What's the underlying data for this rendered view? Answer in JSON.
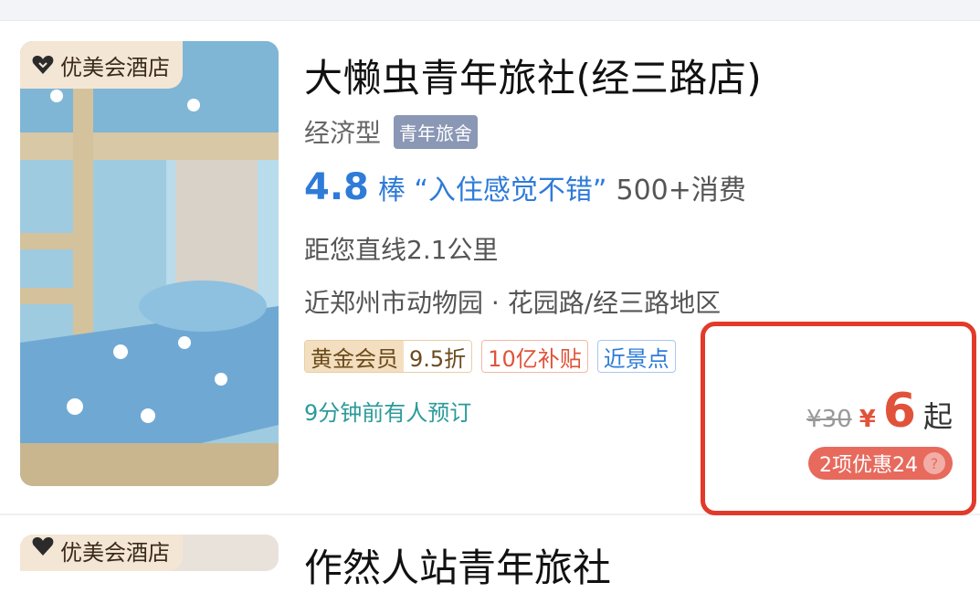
{
  "hotel": {
    "badge": "优美会酒店",
    "title": "大懒虫青年旅社(经三路店)",
    "type": "经济型",
    "type_tag": "青年旅舍",
    "score": "4.8",
    "praise": "棒 “入住感觉不错”",
    "consumption": "500+消费",
    "distance": "距您直线2.1公里",
    "location": "近郑州市动物园 · 花园路/经三路地区",
    "tags": {
      "gold_member": "黄金会员",
      "gold_discount": "9.5折",
      "subsidy": "10亿补贴",
      "scenic": "近景点"
    },
    "booked_recently": "9分钟前有人预订",
    "original_price": "¥30",
    "currency": "¥",
    "price": "6",
    "price_suffix": "起",
    "discount": "2项优惠24",
    "discount_help": "?"
  },
  "next_hotel": {
    "badge": "优美会酒店",
    "title": "作然人站青年旅社"
  },
  "colors": {
    "accent_blue": "#2e7bd8",
    "price_red": "#e0533a",
    "highlight_red": "#e23a2a"
  }
}
